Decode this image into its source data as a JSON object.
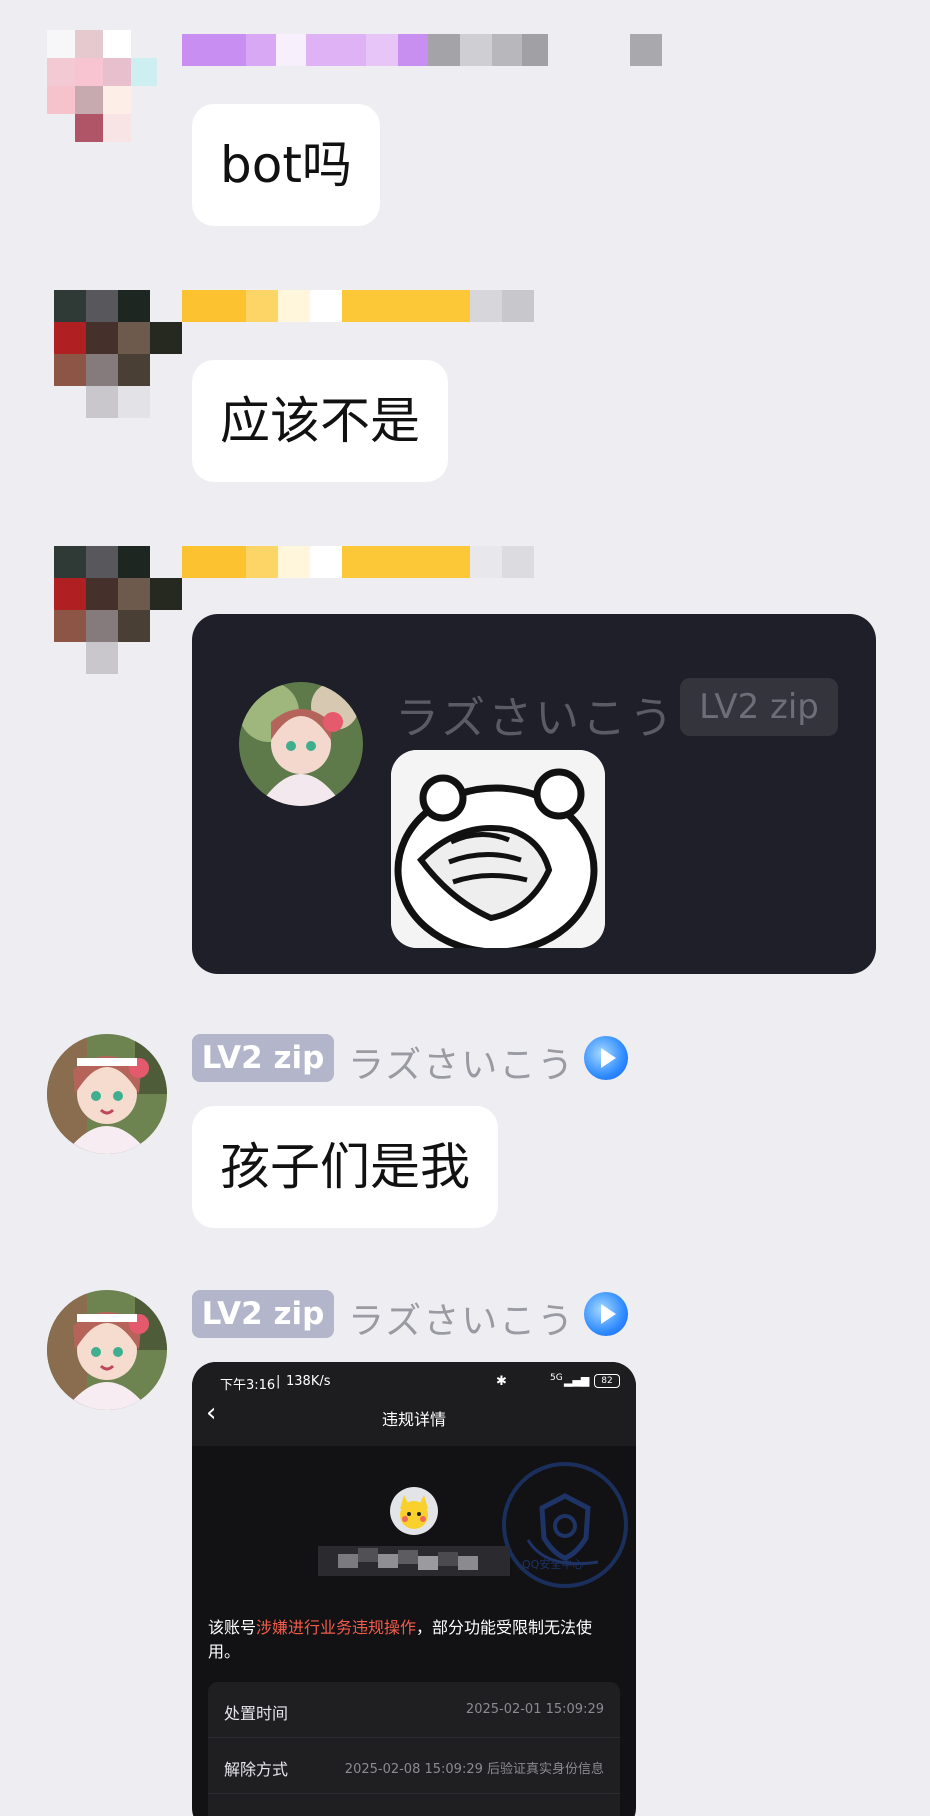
{
  "colors": {
    "chat_background": "#ededf2",
    "bubble": "#ffffff",
    "level_badge": "#b3b6ca",
    "username": "#9a9aa2",
    "dark_card": "#1e1f28",
    "warning_red": "#f25b4b"
  },
  "messages": [
    {
      "sender_name": "",
      "text": "bot吗"
    },
    {
      "sender_name": "",
      "text": "应该不是"
    },
    {
      "sender_name": "",
      "forwarded": {
        "username": "ラズさいこう",
        "level": "LV2 zip",
        "sticker_icon": "bear-facepalm-icon"
      }
    },
    {
      "sender_name": "ラズさいこう",
      "level": "LV2 zip",
      "text": "孩子们是我"
    },
    {
      "sender_name": "ラズさいこう",
      "level": "LV2 zip",
      "screenshot": {
        "status_time": "下午3:16",
        "status_speed": "138K/s",
        "battery": "82",
        "network": "5G",
        "title": "违规详情",
        "watermark": "QQ安全中心",
        "notice_prefix": "该账号",
        "notice_highlight": "涉嫌进行业务违规操作",
        "notice_suffix": "，部分功能受限制无法使用。",
        "rows": [
          {
            "label": "处置时间",
            "value": "2025-02-01 15:09:29"
          },
          {
            "label": "解除方式",
            "value": "2025-02-08 15:09:29 后验证真实身份信息"
          }
        ]
      }
    }
  ]
}
